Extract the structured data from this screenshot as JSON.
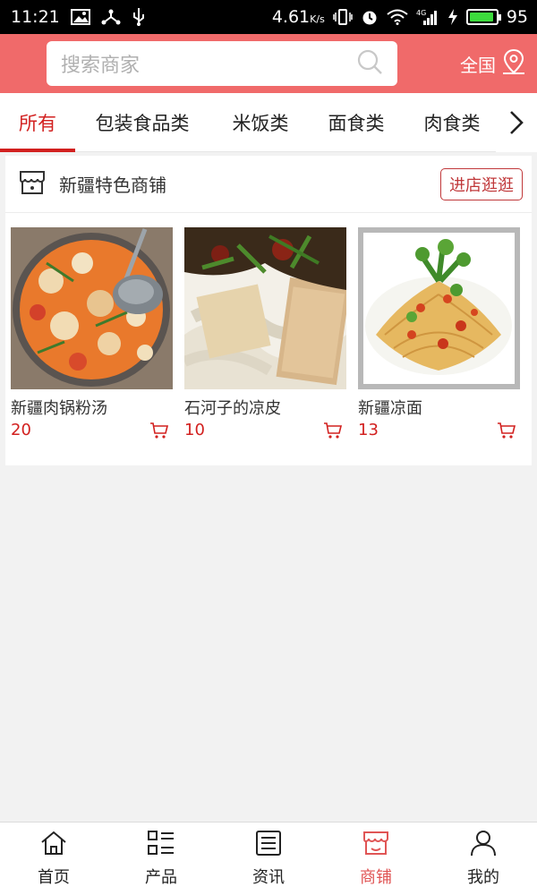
{
  "status_bar": {
    "time": "11:21",
    "net_speed": "4.61",
    "net_unit": "K/s",
    "signal_label": "4G",
    "battery": "95",
    "battery_level": 0.95
  },
  "search": {
    "placeholder": "搜索商家",
    "region_label": "全国"
  },
  "tabs": [
    {
      "label": "所有",
      "active": true
    },
    {
      "label": "包装食品类"
    },
    {
      "label": "米饭类"
    },
    {
      "label": "面食类"
    },
    {
      "label": "肉食类"
    }
  ],
  "shop": {
    "name": "新疆特色商铺",
    "enter_label": "进店逛逛",
    "products": [
      {
        "name": "新疆肉锅粉汤",
        "price": "20"
      },
      {
        "name": "石河子的凉皮",
        "price": "10"
      },
      {
        "name": "新疆凉面",
        "price": "13"
      }
    ]
  },
  "bottom_nav": [
    {
      "label": "首页",
      "icon": "home-icon"
    },
    {
      "label": "产品",
      "icon": "grid-list-icon"
    },
    {
      "label": "资讯",
      "icon": "news-icon"
    },
    {
      "label": "商铺",
      "icon": "store-icon",
      "active": true
    },
    {
      "label": "我的",
      "icon": "user-icon"
    }
  ],
  "colors": {
    "header_bg": "#f06a6a",
    "accent_red": "#d2201f",
    "nav_active": "#e05555"
  }
}
